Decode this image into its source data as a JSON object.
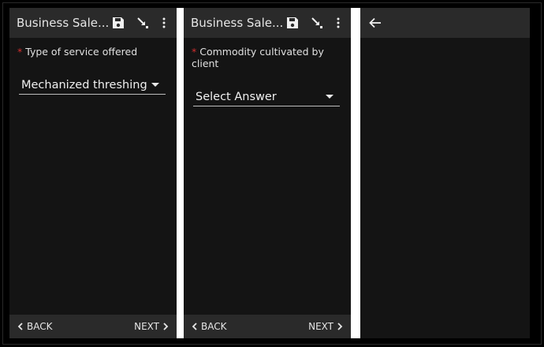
{
  "screens": [
    {
      "title": "Business Sale...",
      "question": {
        "required_mark": "*",
        "label": "Type of service offered"
      },
      "select": {
        "value": "Mechanized threshing"
      },
      "nav": {
        "back": "BACK",
        "next": "NEXT"
      }
    },
    {
      "title": "Business Sale...",
      "question": {
        "required_mark": "*",
        "label": "Commodity cultivated by client"
      },
      "select": {
        "value": "Select Answer"
      },
      "nav": {
        "back": "BACK",
        "next": "NEXT"
      }
    },
    {
      "icon": "back-arrow-icon"
    }
  ],
  "colors": {
    "toolbar": "#2a2a2a",
    "background": "#141414",
    "required": "#d32f2f",
    "divider": "#ffffff"
  },
  "icons": [
    "save-icon",
    "collapse-icon",
    "more-vert-icon",
    "chevron-left-icon",
    "chevron-right-icon",
    "back-arrow-icon"
  ]
}
